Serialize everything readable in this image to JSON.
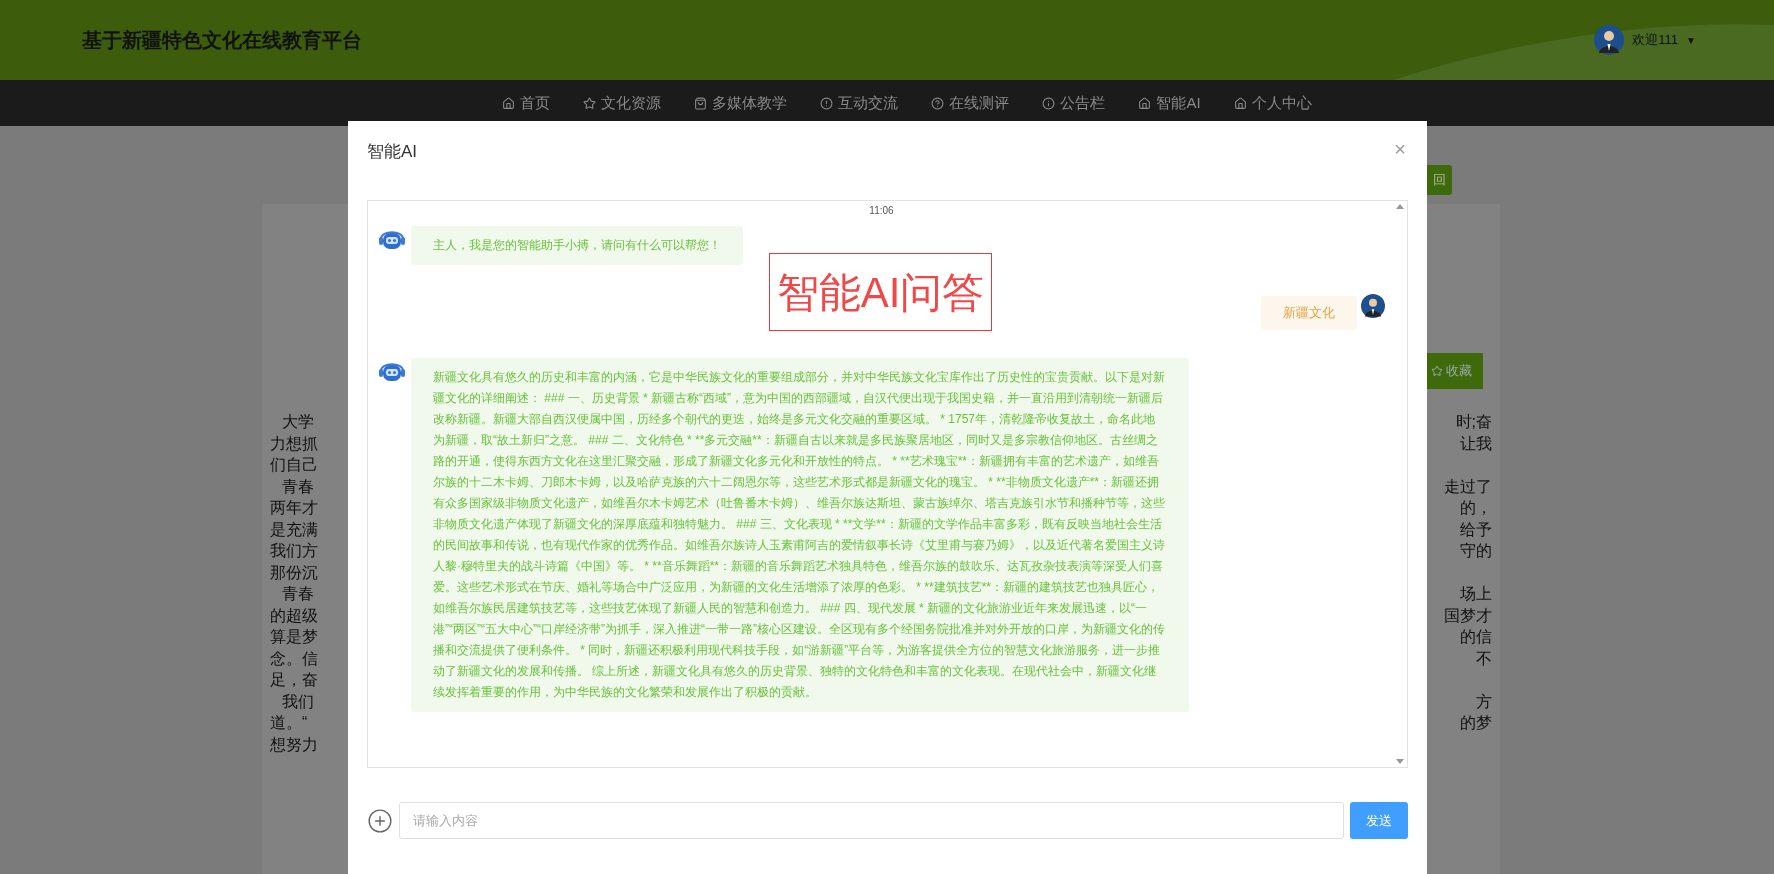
{
  "header": {
    "title": "基于新疆特色文化在线教育平台",
    "greeting": "欢迎111",
    "caret": "▼"
  },
  "nav": [
    {
      "label": "首页",
      "kind": "home"
    },
    {
      "label": "文化资源",
      "kind": "star"
    },
    {
      "label": "多媒体教学",
      "kind": "bag"
    },
    {
      "label": "互动交流",
      "kind": "alert"
    },
    {
      "label": "在线测评",
      "kind": "help"
    },
    {
      "label": "公告栏",
      "kind": "info"
    },
    {
      "label": "智能AI",
      "kind": "home"
    },
    {
      "label": "个人中心",
      "kind": "home"
    }
  ],
  "page": {
    "return_button": "回",
    "favorite_button": "收藏",
    "rows": [
      {
        "left": "大学",
        "indent": true,
        "right": "时;奋"
      },
      {
        "left": "力想抓",
        "indent": false,
        "right": "让我"
      },
      {
        "left": "们自己",
        "indent": false
      },
      {
        "left": "青春",
        "indent": true,
        "right": "走过了"
      },
      {
        "left": "两年才",
        "indent": false,
        "right": "的，"
      },
      {
        "left": "是充满",
        "indent": false,
        "right": "给予"
      },
      {
        "left": "我们方",
        "indent": false,
        "right": "守的"
      },
      {
        "left": "那份沉",
        "indent": false
      },
      {
        "left": "青春",
        "indent": true,
        "right": "场上"
      },
      {
        "left": "的超级",
        "indent": false,
        "right": "国梦才"
      },
      {
        "left": "算是梦",
        "indent": false,
        "right": "的信"
      },
      {
        "left": "念。信",
        "indent": false,
        "right": "不"
      },
      {
        "left": "足，奋",
        "indent": false
      },
      {
        "left": "我们",
        "indent": true,
        "right": "方"
      },
      {
        "left": "道。“",
        "indent": false,
        "right": "的梦"
      },
      {
        "left": "想努力",
        "indent": false
      }
    ]
  },
  "dialog": {
    "title": "智能AI",
    "close": "×",
    "annotation": "智能AI问答",
    "time": "11:06",
    "messages": [
      {
        "kind": "bot",
        "text": "主人，我是您的智能助手小搏，请问有什么可以帮您！"
      },
      {
        "kind": "user",
        "text": "新疆文化"
      },
      {
        "kind": "bot",
        "text": "新疆文化具有悠久的历史和丰富的内涵，它是中华民族文化的重要组成部分，并对中华民族文化宝库作出了历史性的宝贵贡献。以下是对新疆文化的详细阐述： ### 一、历史背景 * 新疆古称“西域”，意为中国的西部疆域，自汉代便出现于我国史籍，并一直沿用到清朝统一新疆后改称新疆。新疆大部自西汉便属中国，历经多个朝代的更迭，始终是多元文化交融的重要区域。 * 1757年，清乾隆帝收复故土，命名此地为新疆，取“故土新归”之意。 ### 二、文化特色 * **多元交融**：新疆自古以来就是多民族聚居地区，同时又是多宗教信仰地区。古丝绸之路的开通，使得东西方文化在这里汇聚交融，形成了新疆文化多元化和开放性的特点。 * **艺术瑰宝**：新疆拥有丰富的艺术遗产，如维吾尔族的十二木卡姆、刀郎木卡姆，以及哈萨克族的六十二阔恩尔等，这些艺术形式都是新疆文化的瑰宝。 * **非物质文化遗产**：新疆还拥有众多国家级非物质文化遗产，如维吾尔木卡姆艺术（吐鲁番木卡姆）、维吾尔族达斯坦、蒙古族绰尔、塔吉克族引水节和播种节等，这些非物质文化遗产体现了新疆文化的深厚底蕴和独特魅力。 ### 三、文化表现 * **文学**：新疆的文学作品丰富多彩，既有反映当地社会生活的民间故事和传说，也有现代作家的优秀作品。如维吾尔族诗人玉素甫阿吉的爱情叙事长诗《艾里甫与赛乃姆》，以及近代著名爱国主义诗人黎·穆特里夫的战斗诗篇《中国》等。 * **音乐舞蹈**：新疆的音乐舞蹈艺术独具特色，维吾尔族的鼓吹乐、达瓦孜杂技表演等深受人们喜爱。这些艺术形式在节庆、婚礼等场合中广泛应用，为新疆的文化生活增添了浓厚的色彩。 * **建筑技艺**：新疆的建筑技艺也独具匠心，如维吾尔族民居建筑技艺等，这些技艺体现了新疆人民的智慧和创造力。 ### 四、现代发展 * 新疆的文化旅游业近年来发展迅速，以“一港”“两区”“五大中心”“口岸经济带”为抓手，深入推进“一带一路”核心区建设。全区现有多个经国务院批准并对外开放的口岸，为新疆文化的传播和交流提供了便利条件。 * 同时，新疆还积极利用现代科技手段，如“游新疆”平台等，为游客提供全方位的智慧文化旅游服务，进一步推动了新疆文化的发展和传播。 综上所述，新疆文化具有悠久的历史背景、独特的文化特色和丰富的文化表现。在现代社会中，新疆文化继续发挥着重要的作用，为中华民族的文化繁荣和发展作出了积极的贡献。"
      }
    ],
    "input": {
      "placeholder": "请输入内容"
    },
    "send_button": "发送"
  }
}
